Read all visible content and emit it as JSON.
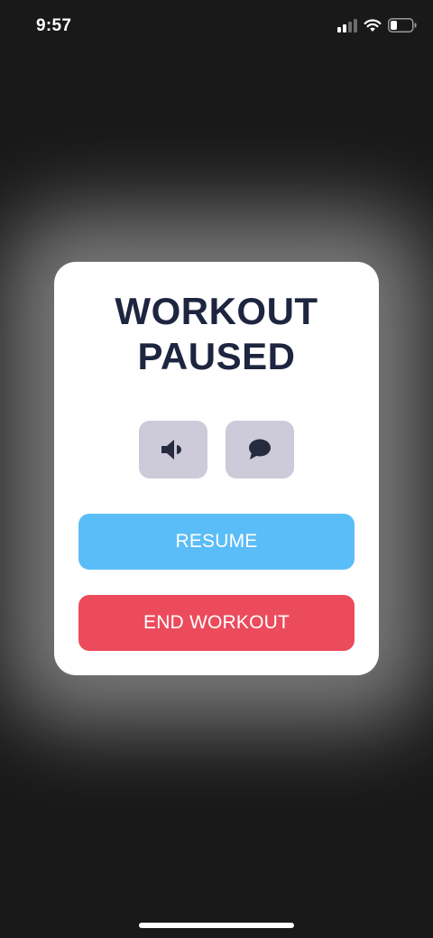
{
  "status_bar": {
    "time": "9:57",
    "icons": [
      "cellular-signal-icon",
      "wifi-icon",
      "battery-icon"
    ]
  },
  "dialog": {
    "title_line1": "WORKOUT",
    "title_line2": "PAUSED",
    "icon_buttons": [
      {
        "icon": "speaker-icon"
      },
      {
        "icon": "chat-bubble-icon"
      }
    ],
    "resume_label": "RESUME",
    "end_label": "END WORKOUT"
  },
  "colors": {
    "background": "#191919",
    "title": "#1e2540",
    "icon_button_bg": "#cdcad9",
    "resume": "#5bbdf7",
    "end": "#ec4b5c"
  }
}
